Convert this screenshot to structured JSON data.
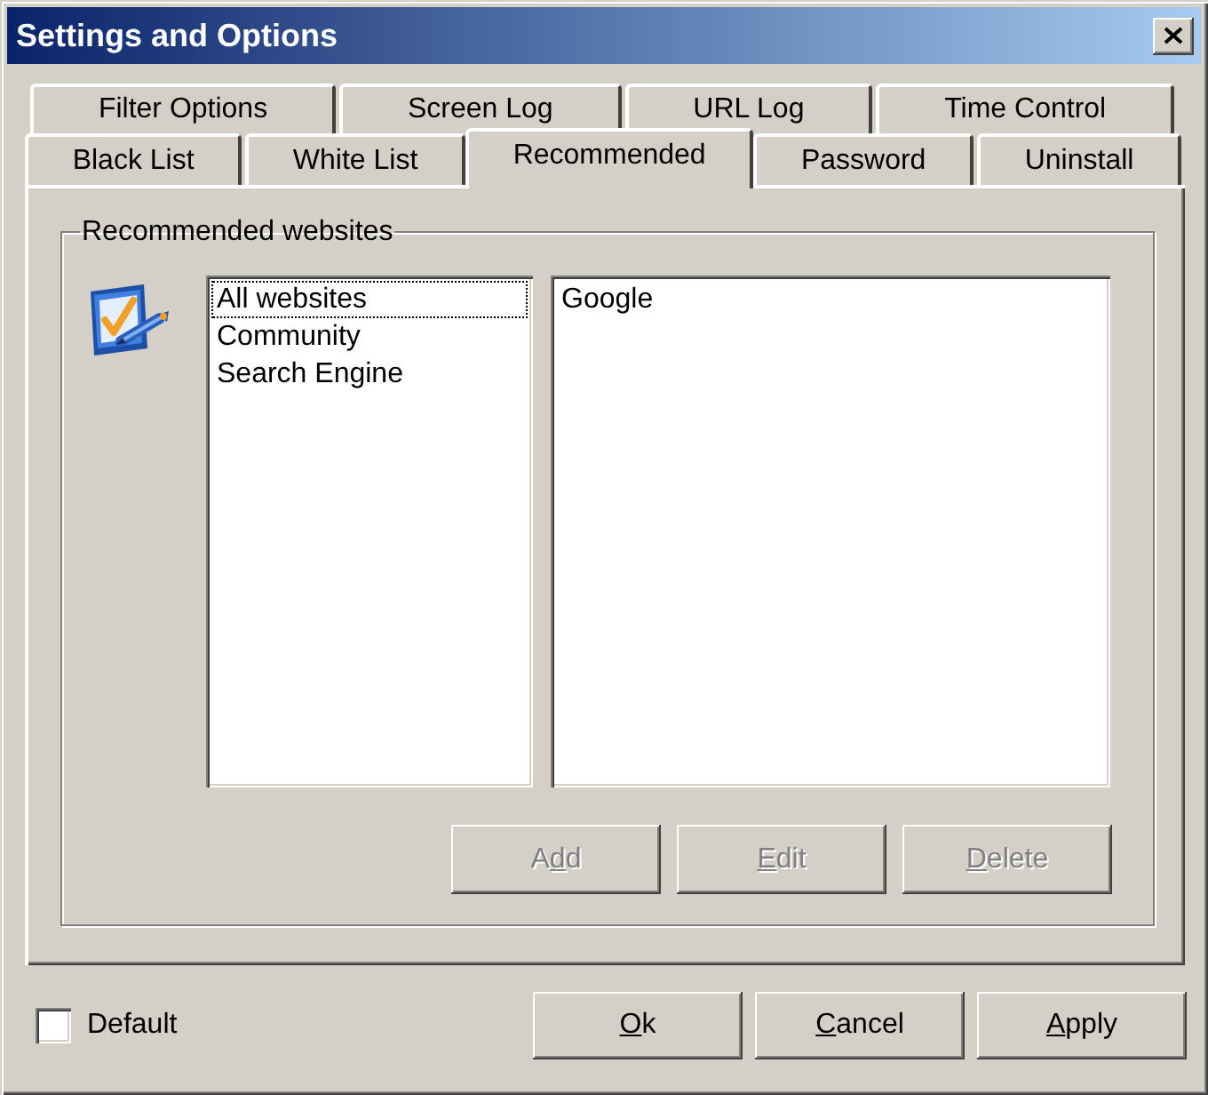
{
  "window": {
    "title": "Settings and Options"
  },
  "tab_rows": [
    {
      "tabs": [
        {
          "label": "Filter Options",
          "selected": false
        },
        {
          "label": "Screen Log",
          "selected": false
        },
        {
          "label": "URL Log",
          "selected": false
        },
        {
          "label": "Time Control",
          "selected": false
        }
      ]
    },
    {
      "tabs": [
        {
          "label": "Black List",
          "selected": false
        },
        {
          "label": "White List",
          "selected": false
        },
        {
          "label": "Recommended",
          "selected": true
        },
        {
          "label": "Password",
          "selected": false
        },
        {
          "label": "Uninstall",
          "selected": false
        }
      ]
    }
  ],
  "group": {
    "title": "Recommended websites"
  },
  "category_list": {
    "items": [
      {
        "label": "All websites",
        "selected": true
      },
      {
        "label": "Community",
        "selected": false
      },
      {
        "label": "Search Engine",
        "selected": false
      }
    ]
  },
  "website_list": {
    "items": [
      {
        "label": "Google",
        "selected": false
      }
    ]
  },
  "list_buttons": [
    {
      "label_start": "A",
      "access_key": "d",
      "label_end": "d",
      "disabled": true
    },
    {
      "access_key": "E",
      "label_end": "dit",
      "disabled": true
    },
    {
      "access_key": "D",
      "label_end": "elete",
      "disabled": true
    }
  ],
  "default_option": {
    "label": "Default",
    "checked": false
  },
  "dialog_buttons": [
    {
      "access_key": "O",
      "label_end": "k",
      "disabled": false
    },
    {
      "access_key": "C",
      "label_end": "ancel",
      "disabled": false
    },
    {
      "access_key": "A",
      "label_end": "pply",
      "disabled": false
    }
  ]
}
